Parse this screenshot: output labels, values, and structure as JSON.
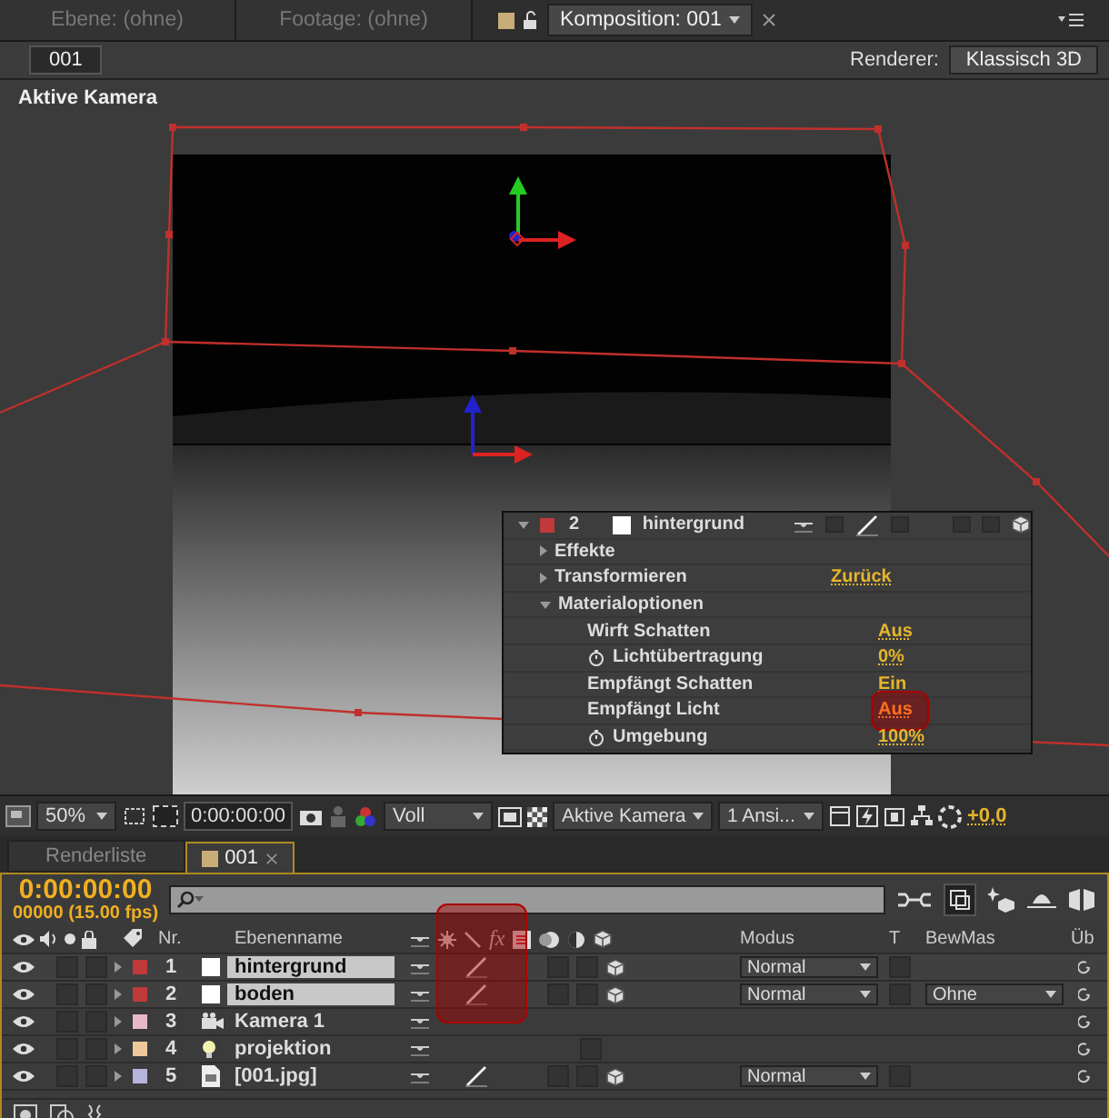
{
  "panel_tabs": [
    {
      "label": "Ebene: (ohne)",
      "selected": false
    },
    {
      "label": "Footage: (ohne)",
      "selected": false
    },
    {
      "label": "Komposition: 001",
      "selected": true
    }
  ],
  "comp_button": "001",
  "renderer": {
    "label": "Renderer:",
    "value": "Klassisch 3D"
  },
  "viewer": {
    "label": "Aktive Kamera"
  },
  "properties": {
    "layer": {
      "number": "2",
      "name": "hintergrund",
      "color": "#c0393b",
      "expanded": true
    },
    "rows": [
      {
        "name": "Effekte",
        "kind": "group",
        "expanded": false
      },
      {
        "name": "Transformieren",
        "kind": "group",
        "expanded": false,
        "value": "Zurück"
      },
      {
        "name": "Materialoptionen",
        "kind": "group",
        "expanded": true
      },
      {
        "name": "Wirft Schatten",
        "kind": "option",
        "value": "Aus",
        "highlighted": false
      },
      {
        "name": "Lichtübertragung",
        "kind": "stopwatch",
        "value": "0%",
        "highlighted": false
      },
      {
        "name": "Empfängt Schatten",
        "kind": "option",
        "value": "Ein",
        "highlighted": false
      },
      {
        "name": "Empfängt Licht",
        "kind": "option",
        "value": "Aus",
        "highlighted": true
      },
      {
        "name": "Umgebung",
        "kind": "stopwatch",
        "value": "100%",
        "highlighted": false
      }
    ]
  },
  "viewer_toolbar": {
    "zoom": "50%",
    "time": "0:00:00:00",
    "resolution": "Voll",
    "camera": "Aktive Kamera",
    "views": "1 Ansi...",
    "exposure": "+0,0"
  },
  "timeline_tabs": [
    {
      "label": "Renderliste",
      "selected": false
    },
    {
      "label": "001",
      "selected": true
    }
  ],
  "timecode": "0:00:00:00",
  "frames": "00000 (15.00 fps)",
  "columns": {
    "number": "Nr.",
    "name": "Ebenenname",
    "effects": "fx",
    "mode": "Modus",
    "t": "T",
    "matte": "BewMas",
    "column_last": "Üb"
  },
  "switches_highlighted": true,
  "layers": [
    {
      "number": "1",
      "name": "hintergrund",
      "color": "#c0393b",
      "kind": "solid",
      "selected": true,
      "quality": true,
      "three_d": true,
      "mode": "Normal"
    },
    {
      "number": "2",
      "name": "boden",
      "color": "#c0393b",
      "kind": "solid",
      "selected": true,
      "quality": true,
      "three_d": true,
      "mode": "Normal",
      "matte": "Ohne"
    },
    {
      "number": "3",
      "name": "Kamera 1",
      "color": "#e8b8c8",
      "kind": "camera",
      "selected": false,
      "quality": false,
      "three_d": false
    },
    {
      "number": "4",
      "name": "projektion",
      "color": "#ecc89a",
      "kind": "light",
      "selected": false,
      "quality": false,
      "three_d": false
    },
    {
      "number": "5",
      "name": "[001.jpg]",
      "color": "#b4b4dc",
      "kind": "footage",
      "selected": false,
      "quality": true,
      "three_d": true,
      "mode": "Normal"
    }
  ]
}
